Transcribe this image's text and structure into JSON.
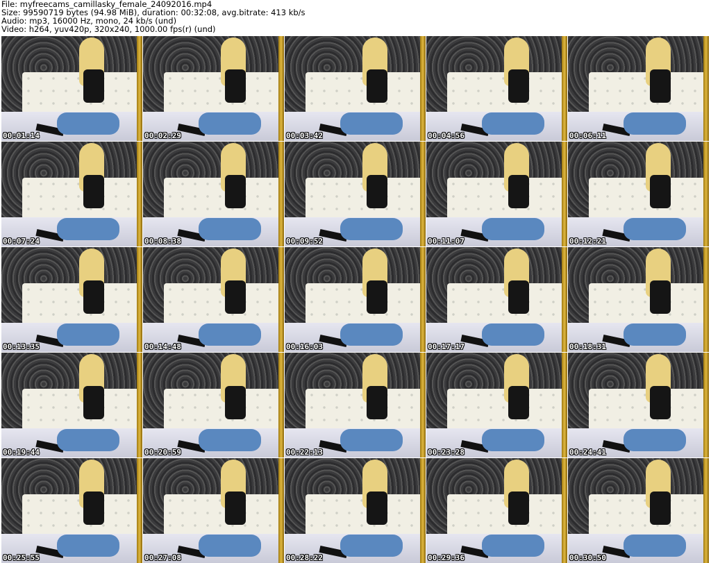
{
  "header": {
    "file": "File: myfreecams_camillasky_female_24092016.mp4",
    "size": "Size: 99590719 bytes (94.98 MiB), duration: 00:32:08, avg.bitrate: 413 kb/s",
    "audio": "Audio: mp3, 16000 Hz, mono, 24 kb/s (und)",
    "video": "Video: h264, yuv420p, 320x240, 1000.00 fps(r) (und)"
  },
  "timestamps": [
    "00:01:14",
    "00:02:29",
    "00:03:42",
    "00:04:56",
    "00:06:11",
    "00:07:24",
    "00:08:38",
    "00:09:52",
    "00:11:07",
    "00:12:21",
    "00:13:35",
    "00:14:48",
    "00:16:03",
    "00:17:17",
    "00:18:31",
    "00:19:44",
    "00:20:59",
    "00:22:13",
    "00:23:28",
    "00:24:41",
    "00:25:55",
    "00:27:08",
    "00:28:22",
    "00:29:36",
    "00:30:50"
  ]
}
